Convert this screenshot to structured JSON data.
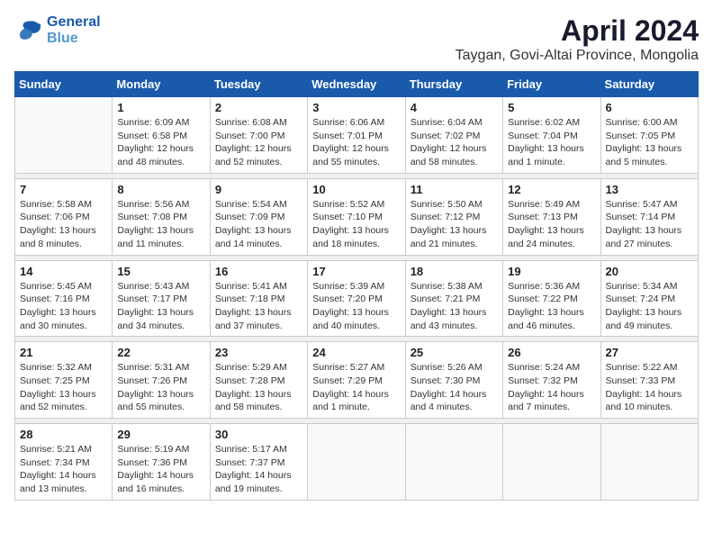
{
  "logo": {
    "line1": "General",
    "line2": "Blue"
  },
  "title": "April 2024",
  "subtitle": "Taygan, Govi-Altai Province, Mongolia",
  "weekdays": [
    "Sunday",
    "Monday",
    "Tuesday",
    "Wednesday",
    "Thursday",
    "Friday",
    "Saturday"
  ],
  "weeks": [
    [
      {
        "day": "",
        "info": ""
      },
      {
        "day": "1",
        "info": "Sunrise: 6:09 AM\nSunset: 6:58 PM\nDaylight: 12 hours\nand 48 minutes."
      },
      {
        "day": "2",
        "info": "Sunrise: 6:08 AM\nSunset: 7:00 PM\nDaylight: 12 hours\nand 52 minutes."
      },
      {
        "day": "3",
        "info": "Sunrise: 6:06 AM\nSunset: 7:01 PM\nDaylight: 12 hours\nand 55 minutes."
      },
      {
        "day": "4",
        "info": "Sunrise: 6:04 AM\nSunset: 7:02 PM\nDaylight: 12 hours\nand 58 minutes."
      },
      {
        "day": "5",
        "info": "Sunrise: 6:02 AM\nSunset: 7:04 PM\nDaylight: 13 hours\nand 1 minute."
      },
      {
        "day": "6",
        "info": "Sunrise: 6:00 AM\nSunset: 7:05 PM\nDaylight: 13 hours\nand 5 minutes."
      }
    ],
    [
      {
        "day": "7",
        "info": "Sunrise: 5:58 AM\nSunset: 7:06 PM\nDaylight: 13 hours\nand 8 minutes."
      },
      {
        "day": "8",
        "info": "Sunrise: 5:56 AM\nSunset: 7:08 PM\nDaylight: 13 hours\nand 11 minutes."
      },
      {
        "day": "9",
        "info": "Sunrise: 5:54 AM\nSunset: 7:09 PM\nDaylight: 13 hours\nand 14 minutes."
      },
      {
        "day": "10",
        "info": "Sunrise: 5:52 AM\nSunset: 7:10 PM\nDaylight: 13 hours\nand 18 minutes."
      },
      {
        "day": "11",
        "info": "Sunrise: 5:50 AM\nSunset: 7:12 PM\nDaylight: 13 hours\nand 21 minutes."
      },
      {
        "day": "12",
        "info": "Sunrise: 5:49 AM\nSunset: 7:13 PM\nDaylight: 13 hours\nand 24 minutes."
      },
      {
        "day": "13",
        "info": "Sunrise: 5:47 AM\nSunset: 7:14 PM\nDaylight: 13 hours\nand 27 minutes."
      }
    ],
    [
      {
        "day": "14",
        "info": "Sunrise: 5:45 AM\nSunset: 7:16 PM\nDaylight: 13 hours\nand 30 minutes."
      },
      {
        "day": "15",
        "info": "Sunrise: 5:43 AM\nSunset: 7:17 PM\nDaylight: 13 hours\nand 34 minutes."
      },
      {
        "day": "16",
        "info": "Sunrise: 5:41 AM\nSunset: 7:18 PM\nDaylight: 13 hours\nand 37 minutes."
      },
      {
        "day": "17",
        "info": "Sunrise: 5:39 AM\nSunset: 7:20 PM\nDaylight: 13 hours\nand 40 minutes."
      },
      {
        "day": "18",
        "info": "Sunrise: 5:38 AM\nSunset: 7:21 PM\nDaylight: 13 hours\nand 43 minutes."
      },
      {
        "day": "19",
        "info": "Sunrise: 5:36 AM\nSunset: 7:22 PM\nDaylight: 13 hours\nand 46 minutes."
      },
      {
        "day": "20",
        "info": "Sunrise: 5:34 AM\nSunset: 7:24 PM\nDaylight: 13 hours\nand 49 minutes."
      }
    ],
    [
      {
        "day": "21",
        "info": "Sunrise: 5:32 AM\nSunset: 7:25 PM\nDaylight: 13 hours\nand 52 minutes."
      },
      {
        "day": "22",
        "info": "Sunrise: 5:31 AM\nSunset: 7:26 PM\nDaylight: 13 hours\nand 55 minutes."
      },
      {
        "day": "23",
        "info": "Sunrise: 5:29 AM\nSunset: 7:28 PM\nDaylight: 13 hours\nand 58 minutes."
      },
      {
        "day": "24",
        "info": "Sunrise: 5:27 AM\nSunset: 7:29 PM\nDaylight: 14 hours\nand 1 minute."
      },
      {
        "day": "25",
        "info": "Sunrise: 5:26 AM\nSunset: 7:30 PM\nDaylight: 14 hours\nand 4 minutes."
      },
      {
        "day": "26",
        "info": "Sunrise: 5:24 AM\nSunset: 7:32 PM\nDaylight: 14 hours\nand 7 minutes."
      },
      {
        "day": "27",
        "info": "Sunrise: 5:22 AM\nSunset: 7:33 PM\nDaylight: 14 hours\nand 10 minutes."
      }
    ],
    [
      {
        "day": "28",
        "info": "Sunrise: 5:21 AM\nSunset: 7:34 PM\nDaylight: 14 hours\nand 13 minutes."
      },
      {
        "day": "29",
        "info": "Sunrise: 5:19 AM\nSunset: 7:36 PM\nDaylight: 14 hours\nand 16 minutes."
      },
      {
        "day": "30",
        "info": "Sunrise: 5:17 AM\nSunset: 7:37 PM\nDaylight: 14 hours\nand 19 minutes."
      },
      {
        "day": "",
        "info": ""
      },
      {
        "day": "",
        "info": ""
      },
      {
        "day": "",
        "info": ""
      },
      {
        "day": "",
        "info": ""
      }
    ]
  ]
}
